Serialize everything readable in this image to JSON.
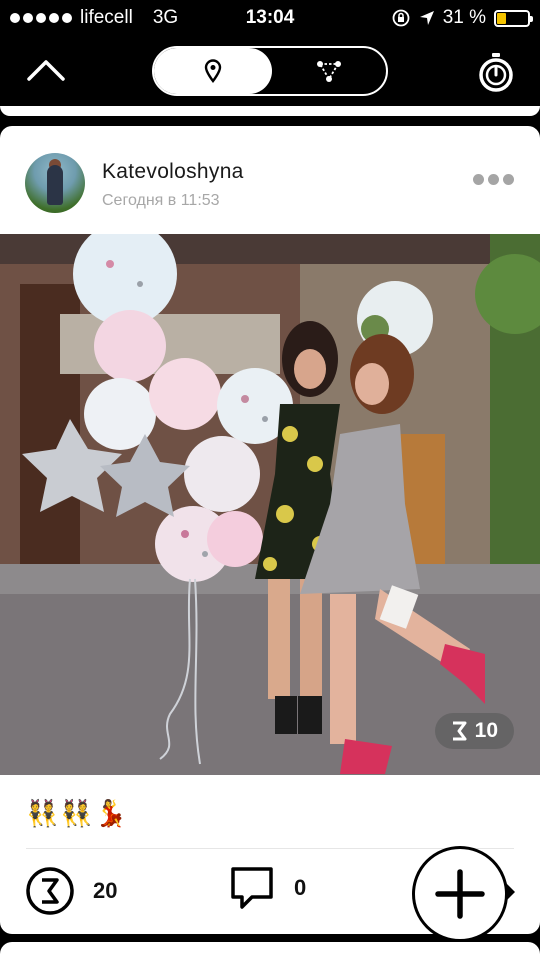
{
  "status_bar": {
    "carrier": "lifecell",
    "network": "3G",
    "time": "13:04",
    "battery_percent": "31 %",
    "battery_level": 0.31
  },
  "nav": {
    "back_icon": "chevron-up-icon",
    "segments": [
      {
        "icon": "location-pin-icon",
        "active": true
      },
      {
        "icon": "network-triangle-icon",
        "active": false
      }
    ],
    "timer_icon": "stopwatch-icon"
  },
  "post": {
    "username": "Katevoloshyna",
    "timestamp": "Сегодня в 11:53",
    "photo_coin_label": "10",
    "emoji": "👯👯💃",
    "coins": "20",
    "comments": "0"
  },
  "colors": {
    "background": "#000000",
    "card": "#ffffff",
    "battery": "#f5c400",
    "muted": "#a7a7a7"
  }
}
